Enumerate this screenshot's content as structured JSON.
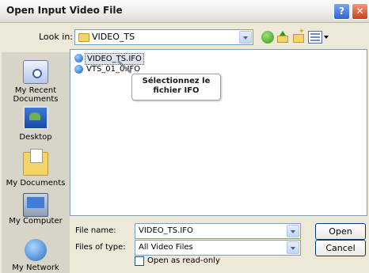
{
  "window": {
    "title": "Open Input Video File",
    "help_glyph": "?",
    "close_glyph": "✕"
  },
  "toolbar": {
    "look_in_label": "Look in:",
    "look_in_value": "VIDEO_TS"
  },
  "places": [
    {
      "label_line1": "My Recent",
      "label_line2": "Documents",
      "icon": "recent-documents-icon"
    },
    {
      "label_line1": "Desktop",
      "label_line2": "",
      "icon": "desktop-icon"
    },
    {
      "label_line1": "My Documents",
      "label_line2": "",
      "icon": "my-documents-icon"
    },
    {
      "label_line1": "My Computer",
      "label_line2": "",
      "icon": "my-computer-icon"
    },
    {
      "label_line1": "My Network",
      "label_line2": "",
      "icon": "my-network-icon"
    }
  ],
  "files": [
    {
      "name": "VIDEO_TS.IFO",
      "selected": true
    },
    {
      "name": "VTS_01_0.IFO",
      "selected": false
    }
  ],
  "callout": {
    "line1": "Sélectionnez le",
    "line2": "fichier IFO"
  },
  "form": {
    "file_name_label": "File name:",
    "file_name_value": "VIDEO_TS.IFO",
    "file_type_label": "Files of type:",
    "file_type_value": "All Video Files",
    "readonly_label": "Open as read-only",
    "readonly_checked": false
  },
  "buttons": {
    "open_label": "Open",
    "cancel_label": "Cancel"
  }
}
